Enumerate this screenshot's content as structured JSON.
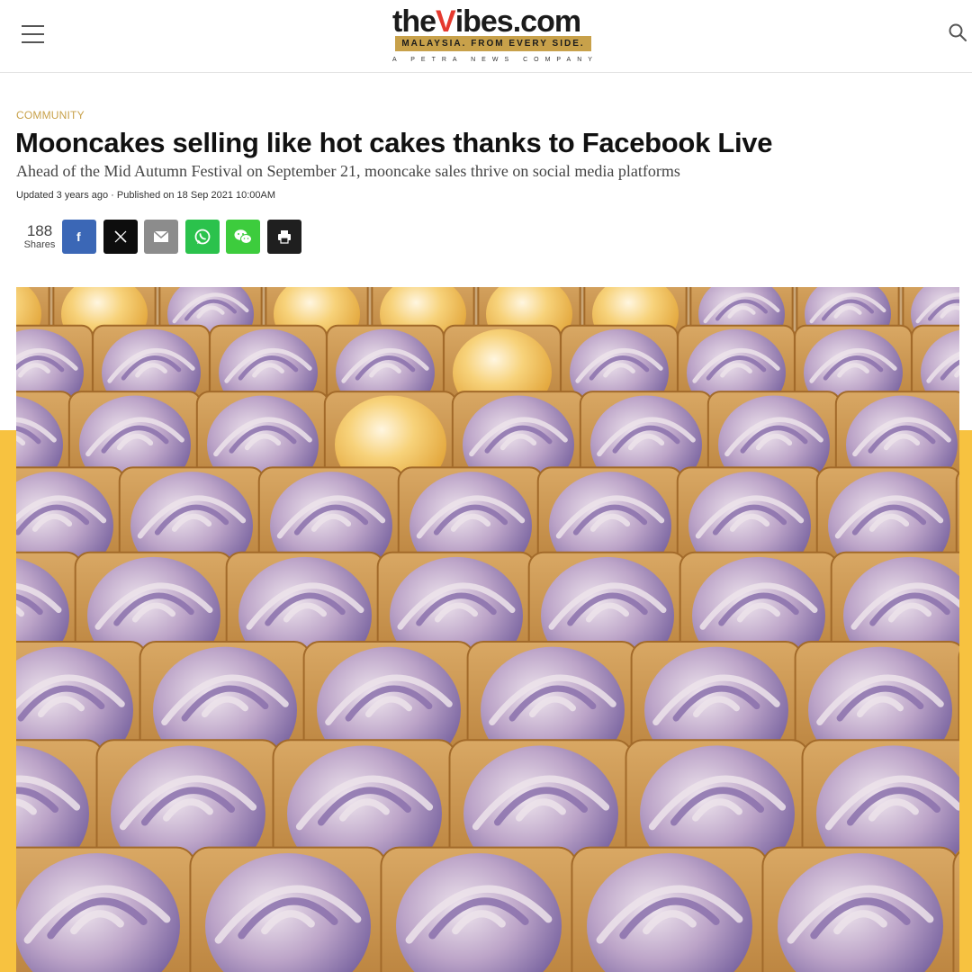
{
  "header": {
    "menu_icon": "hamburger-menu-icon",
    "search_icon": "search-icon",
    "logo": {
      "the": "the",
      "v": "V",
      "ibes": "ibes.com",
      "tagline": "MALAYSIA. FROM EVERY SIDE.",
      "company": "A PETRA NEWS COMPANY"
    }
  },
  "article": {
    "category": "COMMUNITY",
    "title": "Mooncakes selling like hot cakes thanks to Facebook Live",
    "subtitle": "Ahead of the Mid Autumn Festival on September 21, mooncake sales thrive on social media platforms",
    "dateline": "Updated 3 years ago · Published on 18 Sep 2021 10:00AM"
  },
  "share": {
    "count": "188",
    "label": "Shares",
    "buttons": [
      "facebook-icon",
      "x-icon",
      "email-icon",
      "whatsapp-icon",
      "wechat-icon",
      "print-icon"
    ]
  },
  "colors": {
    "accent": "#c8a14a",
    "facebook": "#3b67b6",
    "x": "#0d0d0d",
    "email": "#8c8c8c",
    "whatsapp": "#2bc24c",
    "wechat": "#3dcc3d",
    "print": "#1f1f1f",
    "band": "#f7c240"
  }
}
